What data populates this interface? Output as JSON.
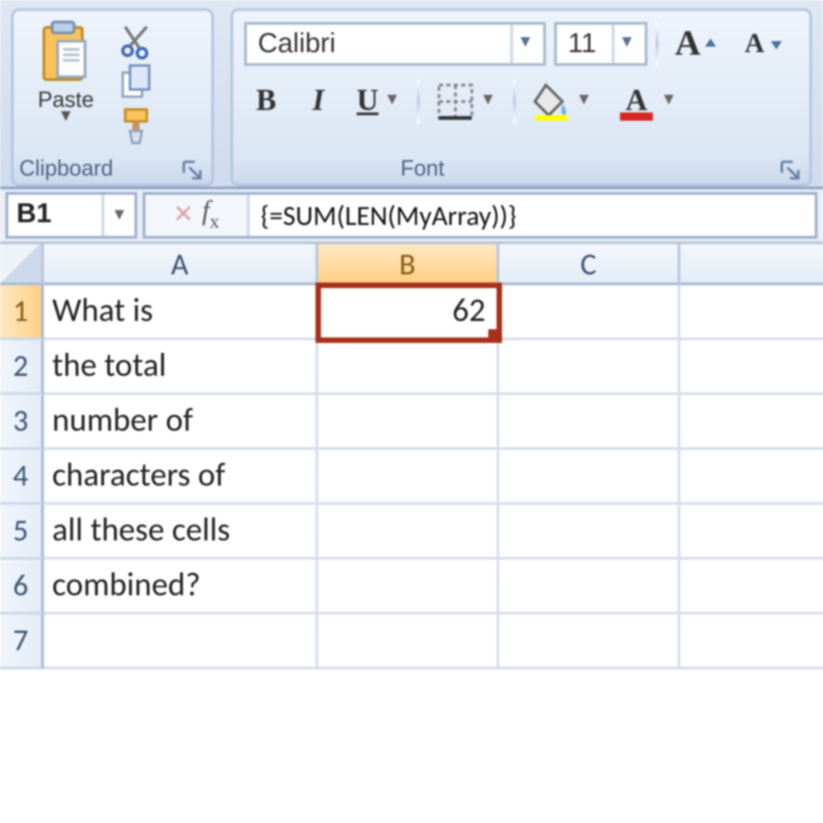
{
  "ribbon": {
    "clipboard": {
      "paste_label": "Paste",
      "group_label": "Clipboard"
    },
    "font": {
      "font_name": "Calibri",
      "font_size": "11",
      "bold": "B",
      "italic": "I",
      "underline": "U",
      "increase_font": "A",
      "decrease_font": "A",
      "group_label": "Font"
    }
  },
  "formula_bar": {
    "name_box": "B1",
    "formula": "{=SUM(LEN(MyArray))}"
  },
  "grid": {
    "columns": [
      "A",
      "B",
      "C"
    ],
    "rows": [
      "1",
      "2",
      "3",
      "4",
      "5",
      "6",
      "7"
    ],
    "selected_cell": "B1",
    "data": {
      "A1": "What is",
      "A2": "the total",
      "A3": "number of",
      "A4": "characters of",
      "A5": "all these cells",
      "A6": "combined?",
      "B1": "62"
    }
  }
}
